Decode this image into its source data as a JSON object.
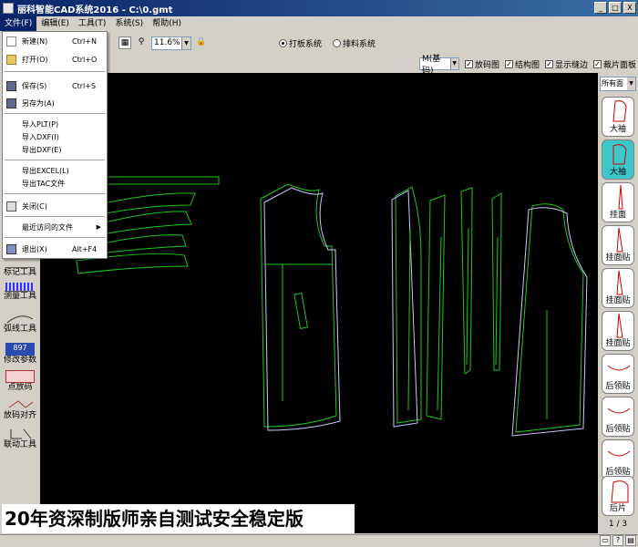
{
  "window": {
    "title": "丽科智能CAD系统2016 - C:\\0.gmt",
    "buttons": [
      "_",
      "□",
      "X"
    ]
  },
  "menubar": [
    {
      "label": "文件(F)",
      "active": true
    },
    {
      "label": "编辑(E)",
      "active": false
    },
    {
      "label": "工具(T)",
      "active": false
    },
    {
      "label": "系统(S)",
      "active": false
    },
    {
      "label": "帮助(H)",
      "active": false
    }
  ],
  "toolbar": {
    "zoom_value": "11.6%",
    "radio_pattern": "打板系统",
    "radio_layout": "排料系统"
  },
  "options_bar": {
    "size_value": "M(基码)",
    "checkboxes": [
      "放码图",
      "结构图",
      "显示缝边",
      "裁片面板"
    ]
  },
  "file_menu": {
    "items": [
      {
        "label": "新建(N)",
        "shortcut": "Ctrl+N",
        "icon": "new-file-icon"
      },
      {
        "label": "打开(O)",
        "shortcut": "Ctrl+O",
        "icon": "open-folder-icon"
      },
      {
        "label": "保存(S)",
        "shortcut": "Ctrl+S",
        "icon": "save-disk-icon"
      },
      {
        "label": "另存为(A)",
        "shortcut": "",
        "icon": "save-as-icon"
      },
      {
        "label": "导入PLT(P)",
        "shortcut": "",
        "icon": ""
      },
      {
        "label": "导入DXF(I)",
        "shortcut": "",
        "icon": ""
      },
      {
        "label": "导出DXF(E)",
        "shortcut": "",
        "icon": ""
      },
      {
        "label": "导出EXCEL(L)",
        "shortcut": "",
        "icon": ""
      },
      {
        "label": "导出TAC文件",
        "shortcut": "",
        "icon": ""
      },
      {
        "label": "关闭(C)",
        "shortcut": "",
        "icon": "printer-icon"
      },
      {
        "label": "最近访问的文件",
        "shortcut": "",
        "icon": "",
        "submenu": true
      },
      {
        "label": "退出(X)",
        "shortcut": "Alt+F4",
        "icon": "exit-icon"
      }
    ]
  },
  "left_tools": [
    {
      "label": "标记工具",
      "icon": "mark-tool-icon"
    },
    {
      "label": "测量工具",
      "icon": "measure-ruler-icon"
    },
    {
      "label": "弧线工具",
      "icon": "arc-tool-icon"
    },
    {
      "label": "修改参数",
      "icon": "edit-param-icon",
      "icon_text": "897"
    },
    {
      "label": "点放码",
      "icon": "point-grade-icon"
    },
    {
      "label": "放码对齐",
      "icon": "grade-align-icon"
    },
    {
      "label": "联动工具",
      "icon": "link-tool-icon"
    }
  ],
  "right_panel": {
    "filter_value": "所有面",
    "pieces": [
      {
        "label": "大袖",
        "selected": false
      },
      {
        "label": "大袖",
        "selected": true
      },
      {
        "label": "挂面",
        "selected": false
      },
      {
        "label": "挂面贴",
        "selected": false
      },
      {
        "label": "挂面贴",
        "selected": false
      },
      {
        "label": "挂面贴",
        "selected": false
      },
      {
        "label": "后领贴",
        "selected": false
      },
      {
        "label": "后领贴",
        "selected": false
      },
      {
        "label": "后领贴",
        "selected": false
      },
      {
        "label": "后片",
        "selected": false
      }
    ],
    "pager": "1 / 3"
  },
  "banner": {
    "text": "20年资深制版师亲自测试安全稳定版"
  },
  "colors": {
    "canvas_bg": "#000000",
    "pattern_outline": "#1ec81e",
    "seam_line": "#c8c8ff",
    "selected_piece": "#3cc8c8"
  }
}
